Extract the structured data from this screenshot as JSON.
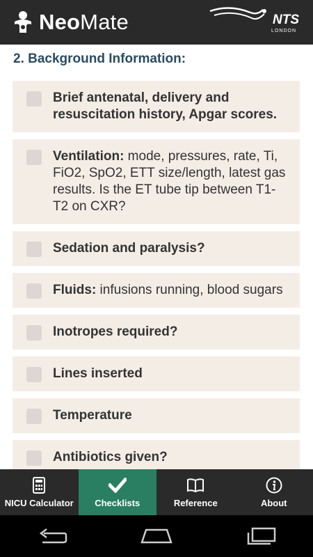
{
  "app": {
    "name_bold": "Neo",
    "name_rest": "Mate",
    "partner": "NTS",
    "partner_sub": "LONDON"
  },
  "section": {
    "title": "2. Background Information:"
  },
  "items": [
    {
      "bold": "Brief antenatal, delivery and resuscitation history, Apgar scores.",
      "rest": ""
    },
    {
      "bold": "Ventilation:",
      "rest": " mode, pressures, rate, Ti, FiO2, SpO2, ETT size/length, latest gas results. Is the ET tube tip between T1-T2 on CXR?"
    },
    {
      "bold": "Sedation and paralysis?",
      "rest": ""
    },
    {
      "bold": "Fluids:",
      "rest": " infusions running, blood sugars"
    },
    {
      "bold": "Inotropes required?",
      "rest": ""
    },
    {
      "bold": "Lines inserted",
      "rest": ""
    },
    {
      "bold": "Temperature",
      "rest": ""
    },
    {
      "bold": "Antibiotics given?",
      "rest": ""
    }
  ],
  "tabs": {
    "calculator": "NICU Calculator",
    "checklists": "Checklists",
    "reference": "Reference",
    "about": "About"
  },
  "colors": {
    "appbar": "#2a2a2a",
    "accent": "#2a7f62",
    "card": "#f4ede6",
    "title": "#2b4b60"
  }
}
